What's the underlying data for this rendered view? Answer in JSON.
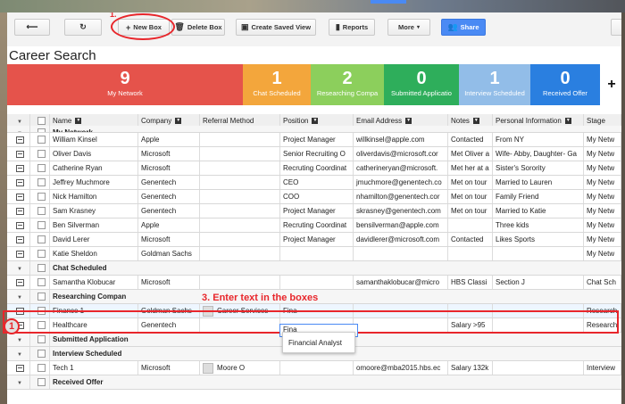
{
  "toolbar": {
    "step_marker": "1.",
    "new_box": "New Box",
    "delete_box": "Delete Box",
    "create_saved_view": "Create Saved View",
    "reports": "Reports",
    "more": "More",
    "share": "Share"
  },
  "page_title": "Career Search",
  "stages": [
    {
      "count": "9",
      "label": "My Network",
      "color": "#e5534b"
    },
    {
      "count": "1",
      "label": "Chat Scheduled",
      "color": "#f3a63c"
    },
    {
      "count": "2",
      "label": "Researching Compa",
      "color": "#8ccf5c"
    },
    {
      "count": "0",
      "label": "Submitted Applicatio",
      "color": "#2eae5b"
    },
    {
      "count": "1",
      "label": "Interview Scheduled",
      "color": "#92bde8"
    },
    {
      "count": "0",
      "label": "Received Offer",
      "color": "#2a7fe0"
    }
  ],
  "add_stage": "+",
  "columns": [
    "Name",
    "Company",
    "Referral Method",
    "Position",
    "Email Address",
    "Notes",
    "Personal Information",
    "Stage"
  ],
  "groups": {
    "my_network": "My Network",
    "chat_scheduled": "Chat Scheduled",
    "researching": "Researching Compan",
    "submitted": "Submitted Application",
    "interview": "Interview Scheduled",
    "received": "Received Offer"
  },
  "network_rows": [
    [
      "William Kinsel",
      "Apple",
      "",
      "Project Manager",
      "willkinsel@apple.com",
      "Contacted",
      "From NY",
      "My Netw"
    ],
    [
      "Oliver Davis",
      "Microsoft",
      "",
      "Senior Recruiting O",
      "oliverdavis@microsoft.cor",
      "Met Oliver a",
      "Wife- Abby, Daughter- Ga",
      "My Netw"
    ],
    [
      "Catherine Ryan",
      "Microsoft",
      "",
      "Recruting Coordinat",
      "catherineryan@microsoft.",
      "Met her at a",
      "Sister's Sorority",
      "My Netw"
    ],
    [
      "Jeffrey Muchmore",
      "Genentech",
      "",
      "CEO",
      "jmuchmore@genentech.co",
      "Met on tour",
      "Married to Lauren",
      "My Netw"
    ],
    [
      "Nick Hamilton",
      "Genentech",
      "",
      "COO",
      "nhamilton@genentech.cor",
      "Met on tour",
      "Family Friend",
      "My Netw"
    ],
    [
      "Sam Krasney",
      "Genentech",
      "",
      "Project Manager",
      "skrasney@genentech.com",
      "Met on tour",
      "Married to Katie",
      "My Netw"
    ],
    [
      "Ben Silverman",
      "Apple",
      "",
      "Recruting Coordinat",
      "bensilverman@apple.com",
      "",
      "Three kids",
      "My Netw"
    ],
    [
      "David Lerer",
      "Microsoft",
      "",
      "Project Manager",
      "davidlerer@microsoft.com",
      "Contacted",
      "Likes Sports",
      "My Netw"
    ],
    [
      "Katie Sheldon",
      "Goldman Sachs",
      "",
      "",
      "",
      "",
      "",
      "My Netw"
    ]
  ],
  "chat_rows": [
    [
      "Samantha Klobucar",
      "Microsoft",
      "",
      "",
      "samanthaklobucar@micro",
      "HBS Classi",
      "Section J",
      "Chat Sch"
    ]
  ],
  "researching_rows": [
    [
      "Finance 1",
      "Goldman Sachs",
      "Career Services",
      "Fina",
      "",
      "",
      "",
      "Research"
    ],
    [
      "Healthcare",
      "Genentech",
      "",
      "",
      "",
      "Salary >95",
      "",
      "Research"
    ]
  ],
  "interview_rows": [
    [
      "Tech 1",
      "Microsoft",
      "Moore O",
      "",
      "omoore@mba2015.hbs.ec",
      "Salary 132k",
      "",
      "Interview"
    ]
  ],
  "step3_text": "3. Enter text in the boxes",
  "badge_text": "1",
  "suggestion": "Financial Analyst"
}
